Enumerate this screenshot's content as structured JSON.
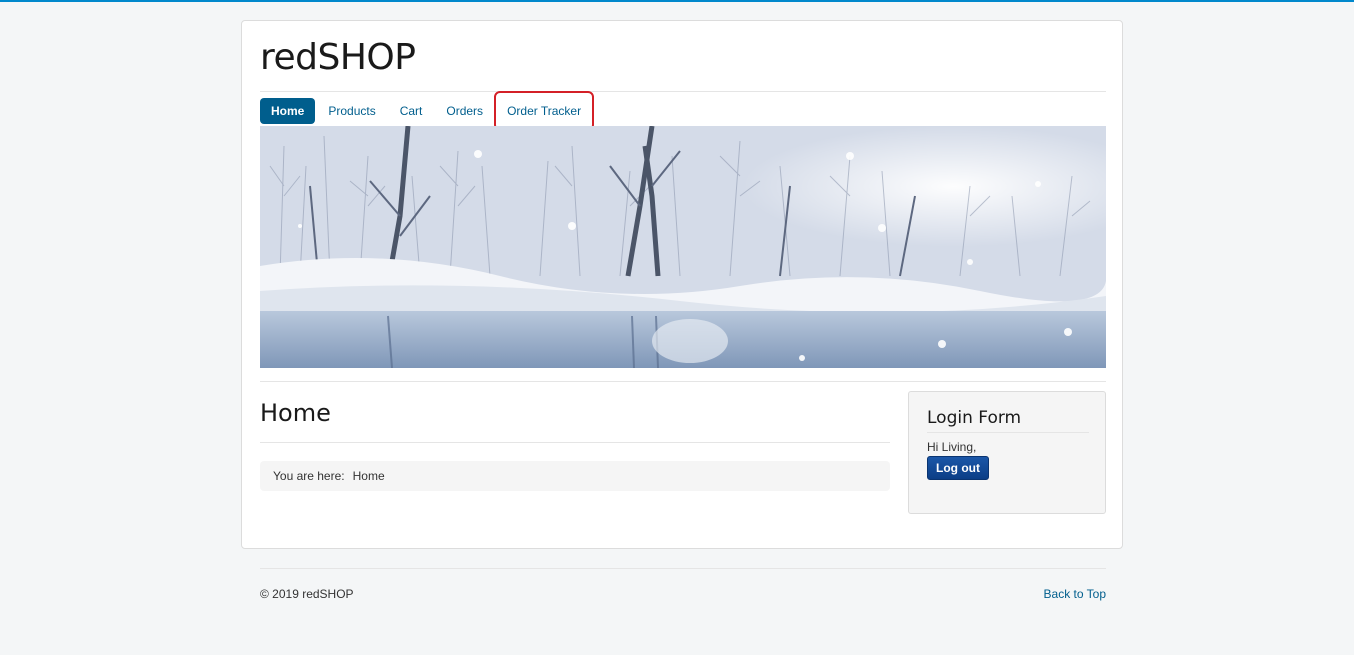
{
  "site": {
    "brand": "redSHOP",
    "accent_color": "#005e8d",
    "stripe_color": "#0088cc"
  },
  "nav": {
    "items": [
      {
        "label": "Home",
        "active": true
      },
      {
        "label": "Products",
        "active": false
      },
      {
        "label": "Cart",
        "active": false
      },
      {
        "label": "Orders",
        "active": false
      },
      {
        "label": "Order Tracker",
        "active": false,
        "highlighted": true
      }
    ],
    "highlight_color": "#d42027"
  },
  "banner": {
    "icon": "winter-landscape-image"
  },
  "main": {
    "heading": "Home",
    "breadcrumb": {
      "prefix": "You are here:",
      "current": "Home"
    }
  },
  "login": {
    "title": "Login Form",
    "greeting": "Hi Living,",
    "logout_label": "Log out",
    "button_color": "#0b3e86"
  },
  "footer": {
    "copyright": "© 2019 redSHOP",
    "back_to_top": "Back to Top"
  }
}
